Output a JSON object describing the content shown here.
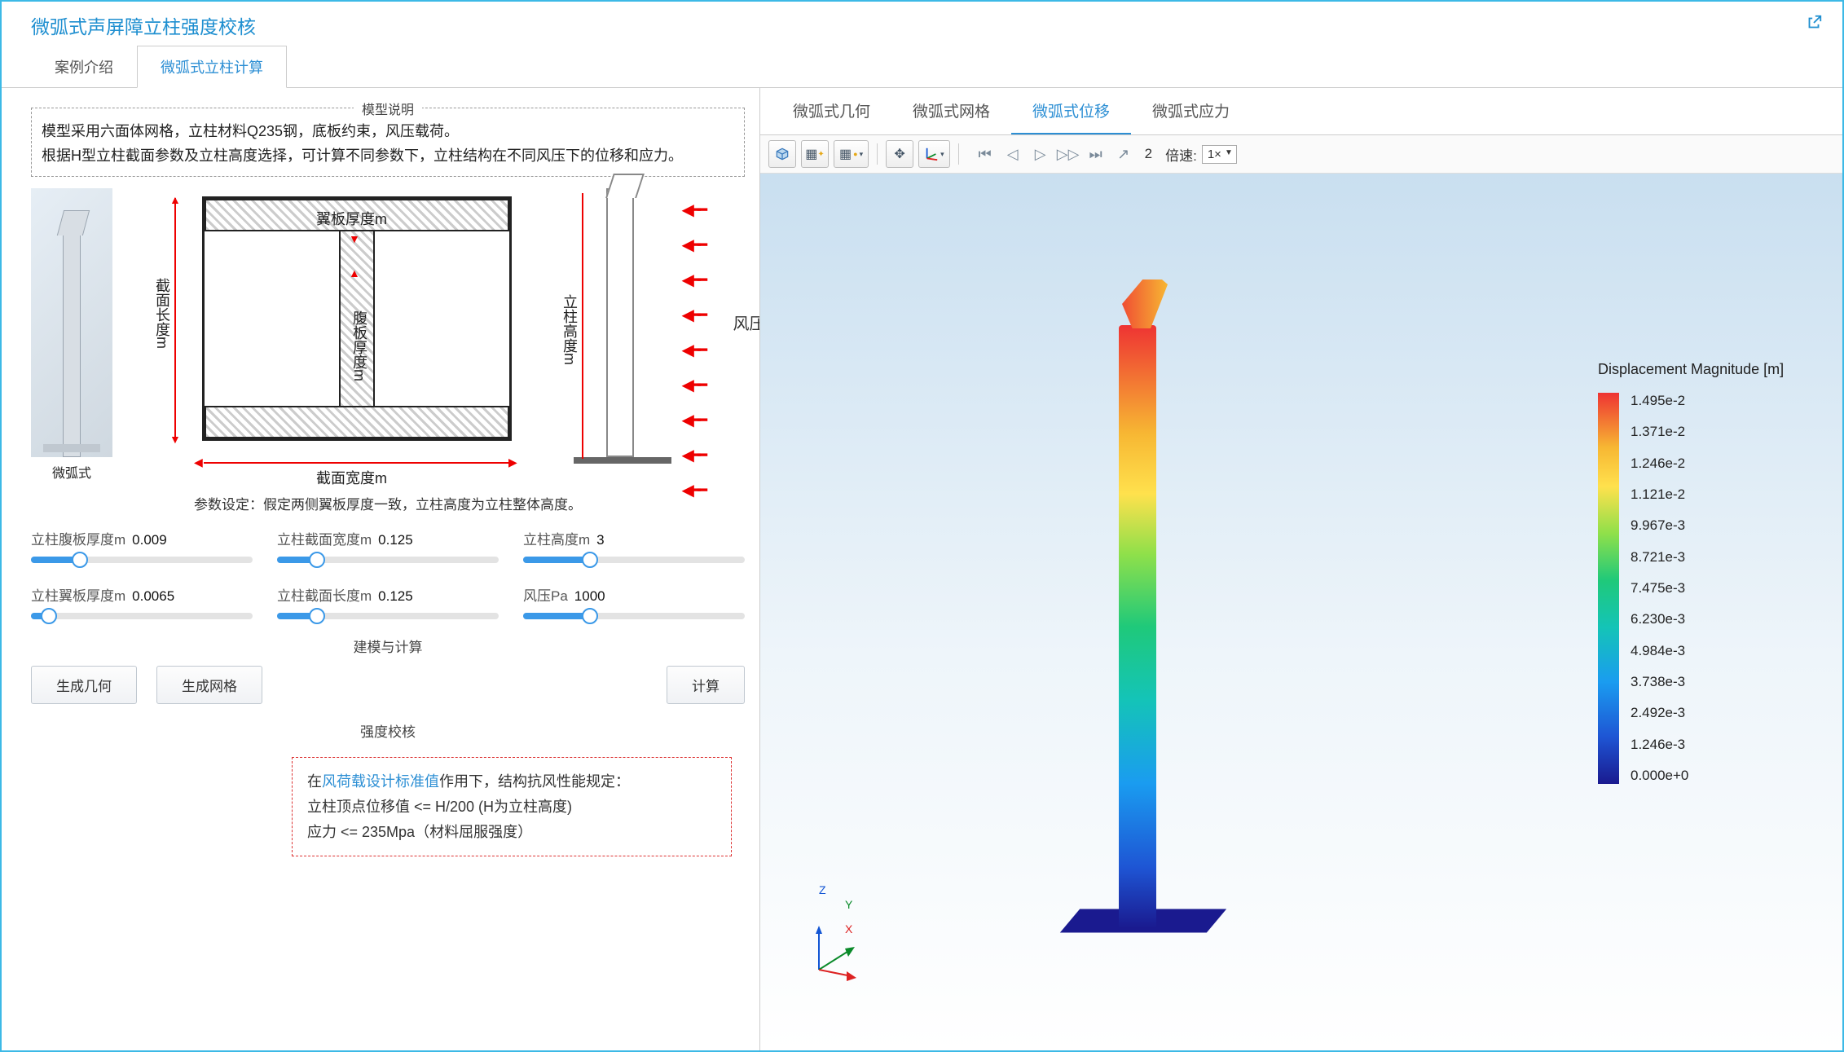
{
  "header": {
    "title": "微弧式声屏障立柱强度校核"
  },
  "mainTabs": {
    "t1": "案例介绍",
    "t2": "微弧式立柱计算",
    "active": 1
  },
  "modelDesc": {
    "legend": "模型说明",
    "line1": "模型采用六面体网格，立柱材料Q235钢，底板约束，风压载荷。",
    "line2": "根据H型立柱截面参数及立柱高度选择，可计算不同参数下，立柱结构在不同风压下的位移和应力。"
  },
  "diagram": {
    "thumbLabel": "微弧式",
    "flangeThk": "翼板厚度m",
    "webThk": "腹板厚度m",
    "secWidth": "截面宽度m",
    "secLen": "截面长度m",
    "colHeight": "立柱高度m",
    "windLabel": "风压Pa",
    "paramNote": "参数设定：假定两侧翼板厚度一致，立柱高度为立柱整体高度。"
  },
  "sliders": [
    {
      "label": "立柱腹板厚度m",
      "value": "0.009",
      "pct": 22
    },
    {
      "label": "立柱截面宽度m",
      "value": "0.125",
      "pct": 18
    },
    {
      "label": "立柱高度m",
      "value": "3",
      "pct": 30
    },
    {
      "label": "立柱翼板厚度m",
      "value": "0.0065",
      "pct": 8
    },
    {
      "label": "立柱截面长度m",
      "value": "0.125",
      "pct": 18
    },
    {
      "label": "风压Pa",
      "value": "1000",
      "pct": 30
    }
  ],
  "build": {
    "legend": "建模与计算",
    "btnGeom": "生成几何",
    "btnMesh": "生成网格",
    "btnCalc": "计算"
  },
  "strength": {
    "legend": "强度校核",
    "l1a": "在",
    "l1link": "风荷载设计标准值",
    "l1b": "作用下，结构抗风性能规定：",
    "l2": "立柱顶点位移值 <= H/200 (H为立柱高度)",
    "l3": "应力 <= 235Mpa（材料屈服强度）"
  },
  "vizTabs": {
    "t1": "微弧式几何",
    "t2": "微弧式网格",
    "t3": "微弧式位移",
    "t4": "微弧式应力",
    "active": 2
  },
  "toolbar": {
    "frame": "2",
    "speedLabel": "倍速:",
    "speedValue": "1×"
  },
  "triad": {
    "x": "X",
    "y": "Y",
    "z": "Z"
  },
  "legend": {
    "title": "Displacement Magnitude [m]",
    "ticks": [
      "1.495e-2",
      "1.371e-2",
      "1.246e-2",
      "1.121e-2",
      "9.967e-3",
      "8.721e-3",
      "7.475e-3",
      "6.230e-3",
      "4.984e-3",
      "3.738e-3",
      "2.492e-3",
      "1.246e-3",
      "0.000e+0"
    ]
  },
  "chart_data": {
    "type": "table",
    "title": "Displacement Magnitude [m]",
    "colorbar_values": [
      0.01495,
      0.01371,
      0.01246,
      0.01121,
      0.009967,
      0.008721,
      0.007475,
      0.00623,
      0.004984,
      0.003738,
      0.002492,
      0.001246,
      0.0
    ],
    "range": [
      0.0,
      0.01495
    ],
    "unit": "m"
  }
}
